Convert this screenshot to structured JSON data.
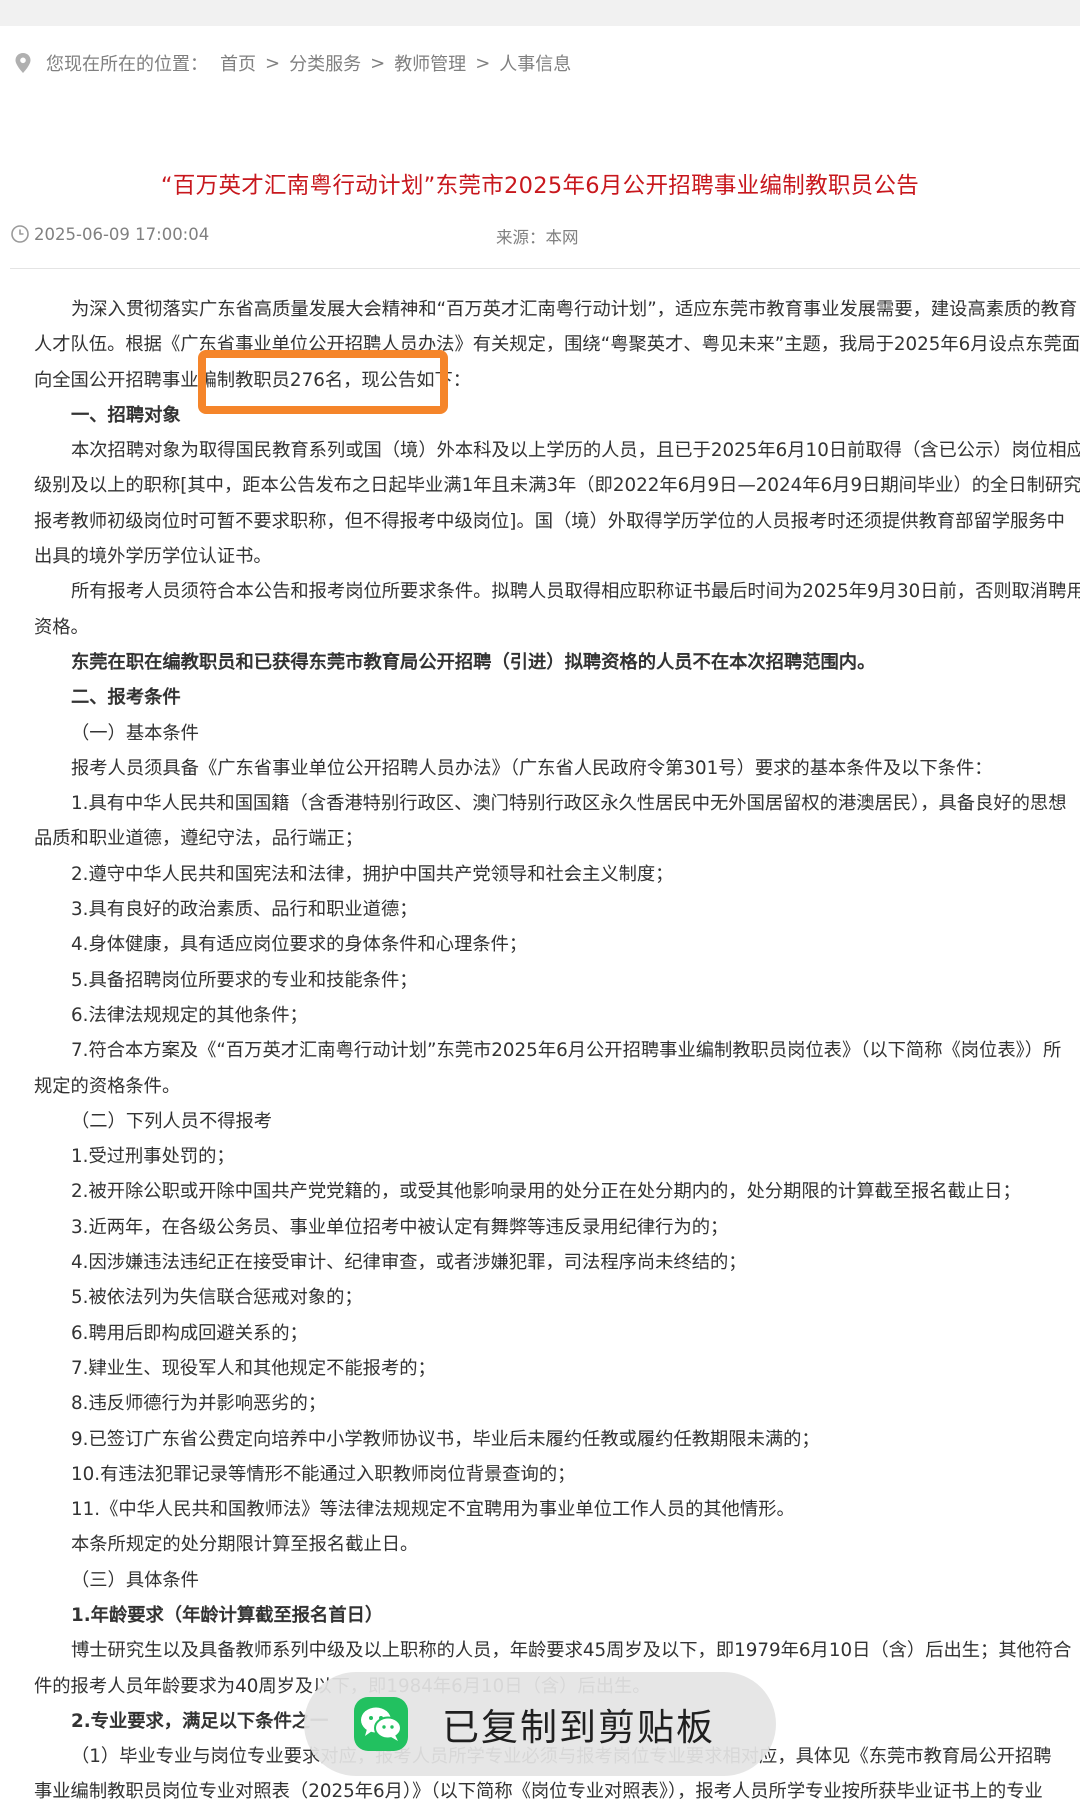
{
  "breadcrumb": {
    "label": "您现在所在的位置：",
    "items": [
      "首页",
      "分类服务",
      "教师管理",
      "人事信息"
    ],
    "separator": ">"
  },
  "article": {
    "title": "“百万英才汇南粤行动计划”东莞市2025年6月公开招聘事业编制教职员公告",
    "datetime": "2025-06-09 17:00:04",
    "source": "来源：本网",
    "lines": [
      "为深入贯彻落实广东省高质量发展大会精神和“百万英才汇南粤行动计划”，适应东莞市教育事业发展需要，建设高素质的教育",
      "人才队伍。根据《广东省事业单位公开招聘人员办法》有关规定，围绕“粤聚英才、粤见未来”主题，我局于2025年6月设点东莞面",
      "向全国公开招聘事业编制教职员276名，现公告如下：",
      "一、招聘对象",
      "本次招聘对象为取得国民教育系列或国（境）外本科及以上学历的人员，且已于2025年6月10日前取得（含已公示）岗位相应",
      "级别及以上的职称[其中，距本公告发布之日起毕业满1年且未满3年（即2022年6月9日—2024年6月9日期间毕业）的全日制研究",
      "报考教师初级岗位时可暂不要求职称，但不得报考中级岗位]。国（境）外取得学历学位的人员报考时还须提供教育部留学服务中",
      "出具的境外学历学位认证书。",
      "所有报考人员须符合本公告和报考岗位所要求条件。拟聘人员取得相应职称证书最后时间为2025年9月30日前，否则取消聘用",
      "资格。",
      "东莞在职在编教职员和已获得东莞市教育局公开招聘（引进）拟聘资格的人员不在本次招聘范围内。",
      "二、报考条件",
      "（一）基本条件",
      "报考人员须具备《广东省事业单位公开招聘人员办法》（广东省人民政府令第301号）要求的基本条件及以下条件：",
      "1.具有中华人民共和国国籍（含香港特别行政区、澳门特别行政区永久性居民中无外国居留权的港澳居民），具备良好的思想",
      "品质和职业道德，遵纪守法，品行端正；",
      "2.遵守中华人民共和国宪法和法律，拥护中国共产党领导和社会主义制度；",
      "3.具有良好的政治素质、品行和职业道德；",
      "4.身体健康，具有适应岗位要求的身体条件和心理条件；",
      "5.具备招聘岗位所要求的专业和技能条件；",
      "6.法律法规规定的其他条件；",
      "7.符合本方案及《“百万英才汇南粤行动计划”东莞市2025年6月公开招聘事业编制教职员岗位表》（以下简称《岗位表》）所",
      "规定的资格条件。",
      "（二）下列人员不得报考",
      "1.受过刑事处罚的；",
      "2.被开除公职或开除中国共产党党籍的，或受其他影响录用的处分正在处分期内的，处分期限的计算截至报名截止日；",
      "3.近两年，在各级公务员、事业单位招考中被认定有舞弊等违反录用纪律行为的；",
      "4.因涉嫌违法违纪正在接受审计、纪律审查，或者涉嫌犯罪，司法程序尚未终结的；",
      "5.被依法列为失信联合惩戒对象的；",
      "6.聘用后即构成回避关系的；",
      "7.肄业生、现役军人和其他规定不能报考的；",
      "8.违反师德行为并影响恶劣的；",
      "9.已签订广东省公费定向培养中小学教师协议书，毕业后未履约任教或履约任教期限未满的；",
      "10.有违法犯罪记录等情形不能通过入职教师岗位背景查询的；",
      "11.《中华人民共和国教师法》等法律法规规定不宜聘用为事业单位工作人员的其他情形。",
      "本条所规定的处分期限计算至报名截止日。",
      "（三）具体条件",
      "1.年龄要求（年龄计算截至报名首日）",
      "博士研究生以及具备教师系列中级及以上职称的人员，年龄要求45周岁及以下，即1979年6月10日（含）后出生；其他符合",
      "件的报考人员年龄要求为40周岁及以下，即1984年6月10日（含）后出生。",
      "2.专业要求，满足以下条件之一",
      "（1）毕业专业与岗位专业要求对应，报考人员所学专业必须与报考岗位专业要求相对应，具体见《东莞市教育局公开招聘",
      "事业编制教职员岗位专业对照表（2025年6月）》（以下简称《岗位专业对照表》），报考人员所学专业按所获毕业证书上的专业"
    ]
  },
  "toast": {
    "message": "已复制到剪贴板",
    "icon": "wechat-icon"
  },
  "colors": {
    "title": "#c8171d",
    "highlight": "#f5852a",
    "wechat": "#22c160"
  }
}
